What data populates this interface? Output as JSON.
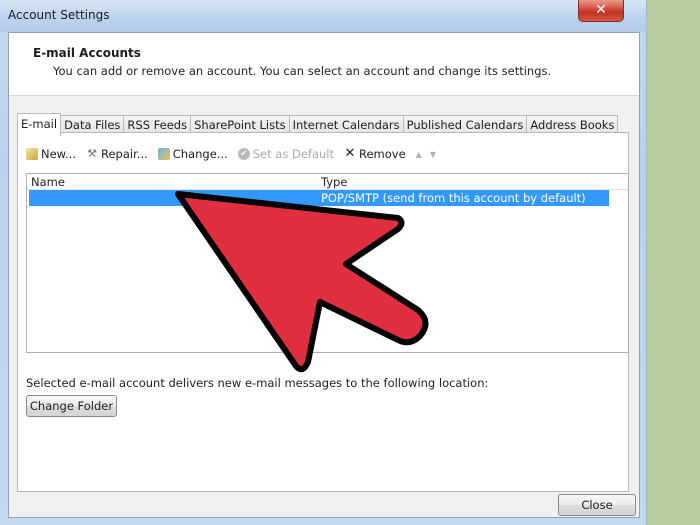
{
  "window": {
    "title": "Account Settings",
    "close_glyph": "✕"
  },
  "header": {
    "title": "E-mail Accounts",
    "subtitle": "You can add or remove an account. You can select an account and change its settings."
  },
  "tabs": [
    {
      "label": "E-mail",
      "active": true
    },
    {
      "label": "Data Files",
      "active": false
    },
    {
      "label": "RSS Feeds",
      "active": false
    },
    {
      "label": "SharePoint Lists",
      "active": false
    },
    {
      "label": "Internet Calendars",
      "active": false
    },
    {
      "label": "Published Calendars",
      "active": false
    },
    {
      "label": "Address Books",
      "active": false
    }
  ],
  "toolbar": {
    "new_label": "New...",
    "repair_label": "Repair...",
    "change_label": "Change...",
    "set_default_label": "Set as Default",
    "remove_label": "Remove",
    "move_up_glyph": "▲",
    "move_down_glyph": "▼"
  },
  "accounts_list": {
    "columns": [
      "Name",
      "Type"
    ],
    "rows": [
      {
        "name": "",
        "type": "POP/SMTP (send from this account by default)",
        "selected": true
      }
    ]
  },
  "delivery": {
    "text": "Selected e-mail account delivers new e-mail messages to the following location:",
    "change_folder_label": "Change Folder"
  },
  "footer": {
    "close_label": "Close"
  },
  "annotation": {
    "type": "pointer-arrow",
    "color": "#e03040",
    "outline": "#000000"
  }
}
